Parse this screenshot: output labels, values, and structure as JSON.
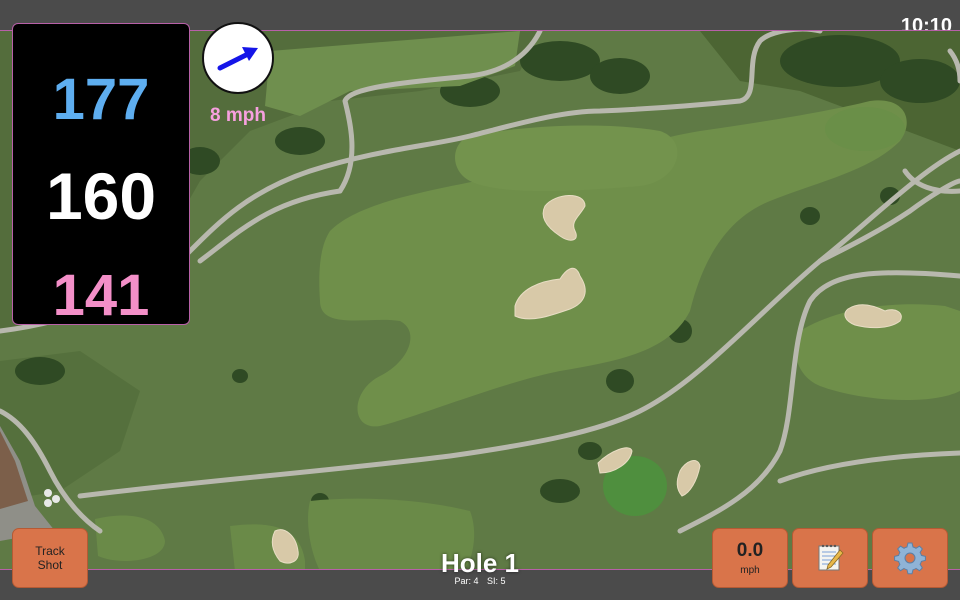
{
  "status": {
    "clock": "10:10"
  },
  "distances": {
    "back": "177",
    "middle": "160",
    "front": "141"
  },
  "wind": {
    "speed": "8 mph",
    "icon": "wind-direction-arrow-icon",
    "direction": "east-northeast"
  },
  "hole": {
    "title": "Hole 1",
    "par": "Par: 4",
    "stroke_index": "SI: 5"
  },
  "buttons": {
    "track_shot_line1": "Track",
    "track_shot_line2": "Shot",
    "speed_value": "0.0",
    "speed_unit": "mph",
    "notes_icon": "notepad-icon",
    "settings_icon": "gear-icon"
  },
  "colors": {
    "back_distance": "#5eaef0",
    "middle_distance": "#ffffff",
    "front_distance": "#f38fc8",
    "wind_text": "#f7a0e0",
    "button": "#d9744a",
    "frame_border": "#b860a8"
  }
}
